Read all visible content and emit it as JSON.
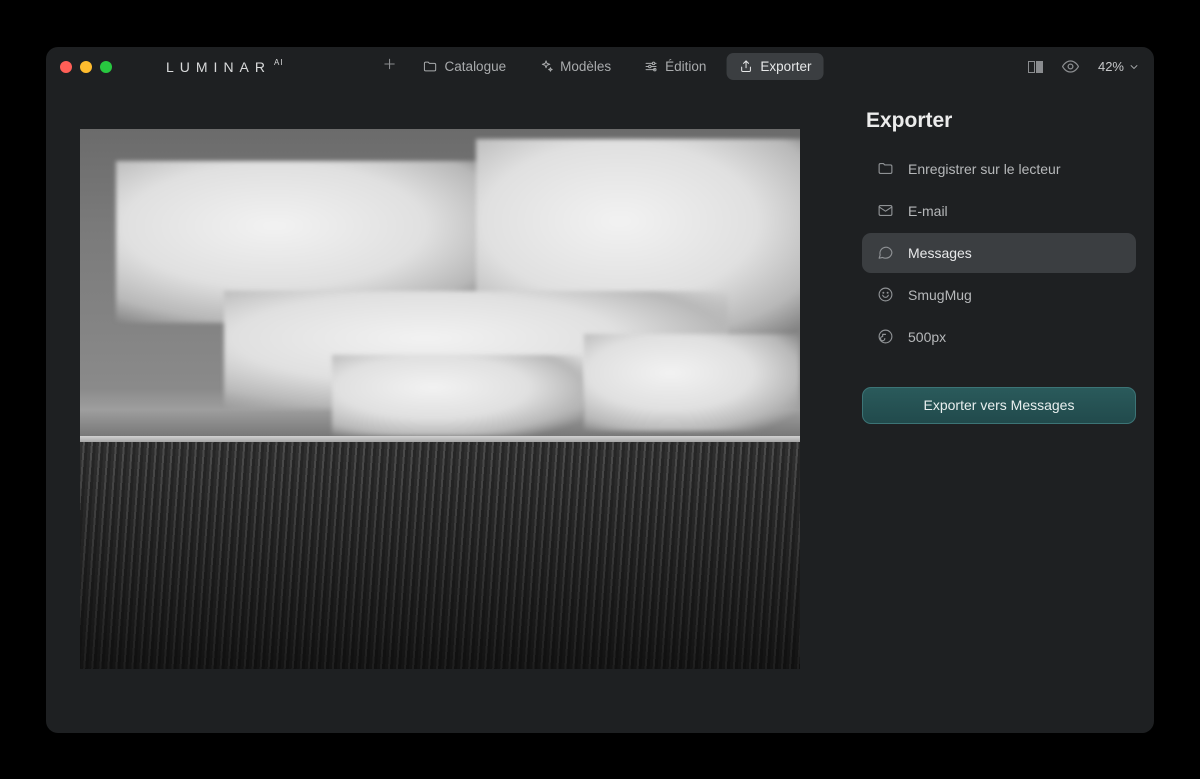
{
  "app": {
    "name": "LUMINAR",
    "badge": "AI"
  },
  "nav": {
    "catalogue": "Catalogue",
    "models": "Modèles",
    "edition": "Édition",
    "export": "Exporter"
  },
  "toolbar": {
    "zoom": "42%"
  },
  "sidebar": {
    "title": "Exporter",
    "options": [
      {
        "label": "Enregistrer sur le lecteur",
        "icon": "folder"
      },
      {
        "label": "E-mail",
        "icon": "mail"
      },
      {
        "label": "Messages",
        "icon": "messages",
        "selected": true
      },
      {
        "label": "SmugMug",
        "icon": "smugmug"
      },
      {
        "label": "500px",
        "icon": "500px"
      }
    ],
    "action_button": "Exporter vers Messages"
  }
}
